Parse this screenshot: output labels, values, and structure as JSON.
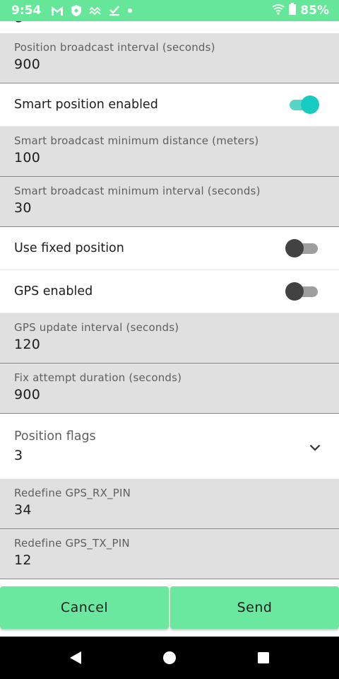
{
  "status_bar": {
    "time": "9:54",
    "notification_icons": [
      "gmail-icon",
      "shield-icon",
      "signal-wave-icon",
      "download-check-icon",
      "dot-icon"
    ],
    "battery_percent": "85%"
  },
  "header": {
    "title_fragment": "g"
  },
  "fields": {
    "position_broadcast_interval": {
      "label": "Position broadcast interval (seconds)",
      "value": "900"
    },
    "smart_position_enabled": {
      "label": "Smart position enabled",
      "on": true
    },
    "smart_min_distance": {
      "label": "Smart broadcast minimum distance (meters)",
      "value": "100"
    },
    "smart_min_interval": {
      "label": "Smart broadcast minimum interval (seconds)",
      "value": "30"
    },
    "use_fixed_position": {
      "label": "Use fixed position",
      "on": false
    },
    "gps_enabled": {
      "label": "GPS enabled",
      "on": false
    },
    "gps_update_interval": {
      "label": "GPS update interval (seconds)",
      "value": "120"
    },
    "fix_attempt_duration": {
      "label": "Fix attempt duration (seconds)",
      "value": "900"
    },
    "position_flags": {
      "label": "Position flags",
      "value": "3"
    },
    "gps_rx_pin": {
      "label": "Redefine GPS_RX_PIN",
      "value": "34"
    },
    "gps_tx_pin": {
      "label": "Redefine GPS_TX_PIN",
      "value": "12"
    }
  },
  "buttons": {
    "cancel": "Cancel",
    "send": "Send"
  },
  "colors": {
    "status_bar": "#66e699",
    "button": "#6ae8a0",
    "switch_on": "#16ccc0",
    "field_bg": "#e0e0e0"
  }
}
